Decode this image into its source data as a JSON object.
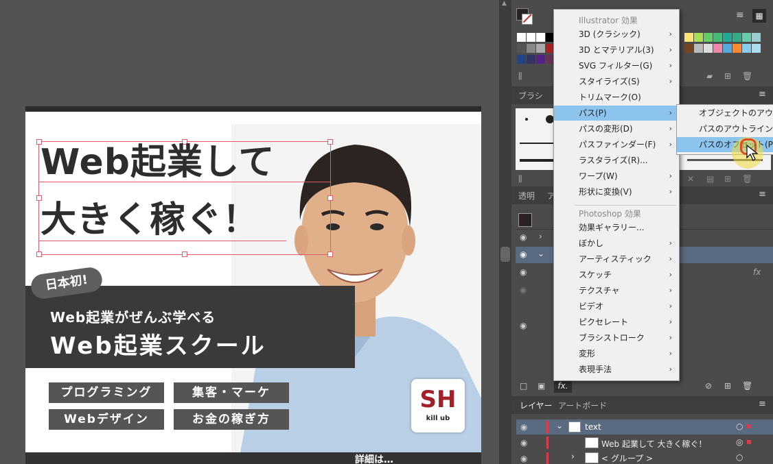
{
  "artboard": {
    "headline_line1": "Web起業して",
    "headline_line2": "大きく稼ぐ！",
    "badge": "日本初!",
    "subtitle": "Web起業がぜんぶ学べる",
    "school_name": "Web起業スクール",
    "tags": [
      "プログラミング",
      "集客・マーケ",
      "Webデザイン",
      "お金の稼ぎ方"
    ],
    "logo_top": "SH",
    "logo_bottom": "kill ub",
    "bottom_text": "詳細は…"
  },
  "swatch_panel": {
    "colors": [
      "#ffffff",
      "#e8e8e8",
      "#000000",
      "#cc2222",
      "#eeee33",
      "#33aa44",
      "#22aadd",
      "#2233aa",
      "#aa3399",
      "#333377",
      "#662288",
      "#883355",
      "#ffe9a8",
      "#66bb44",
      "#44cc88",
      "#11aa66",
      "#338855",
      "#cc8866",
      "#995533",
      "#777777",
      "#e8a0c8",
      "#ffcc88",
      "#ff8833",
      "#88ccee"
    ]
  },
  "panels": {
    "brush_tab": "ブラシ",
    "transparency_tab": "透明",
    "appearance_tab_short": "ア",
    "layers_tab": "レイヤー",
    "artboards_tab": "アートボード",
    "fx_label": "fx.",
    "fx_italic": "fx"
  },
  "effect_menu": {
    "illustrator_header": "Illustrator 効果",
    "illustrator_items": [
      {
        "label": "3D (クラシック)",
        "submenu": true
      },
      {
        "label": "3D とマテリアル(3)",
        "submenu": true
      },
      {
        "label": "SVG フィルター(G)",
        "submenu": true
      },
      {
        "label": "スタイライズ(S)",
        "submenu": true
      },
      {
        "label": "トリムマーク(O)",
        "submenu": false
      },
      {
        "label": "パス(P)",
        "submenu": true
      },
      {
        "label": "パスの変形(D)",
        "submenu": true
      },
      {
        "label": "パスファインダー(F)",
        "submenu": true
      },
      {
        "label": "ラスタライズ(R)...",
        "submenu": false
      },
      {
        "label": "ワープ(W)",
        "submenu": true
      },
      {
        "label": "形状に変換(V)",
        "submenu": true
      }
    ],
    "photoshop_header": "Photoshop 効果",
    "photoshop_items": [
      {
        "label": "効果ギャラリー...",
        "submenu": false
      },
      {
        "label": "ぼかし",
        "submenu": true
      },
      {
        "label": "アーティスティック",
        "submenu": true
      },
      {
        "label": "スケッチ",
        "submenu": true
      },
      {
        "label": "テクスチャ",
        "submenu": true
      },
      {
        "label": "ビデオ",
        "submenu": true
      },
      {
        "label": "ピクセレート",
        "submenu": true
      },
      {
        "label": "ブラシストローク",
        "submenu": true
      },
      {
        "label": "変形",
        "submenu": true
      },
      {
        "label": "表現手法",
        "submenu": true
      }
    ],
    "arrow": "›"
  },
  "path_submenu": {
    "items": [
      "オブジェクトのアウトライン",
      "パスのアウトライン(S)",
      "パスのオフセット(P)..."
    ]
  },
  "layers": {
    "rows": [
      {
        "name": "text"
      },
      {
        "name": "Web 起業して 大きく稼ぐ！"
      },
      {
        "name": "< グループ >"
      }
    ]
  }
}
